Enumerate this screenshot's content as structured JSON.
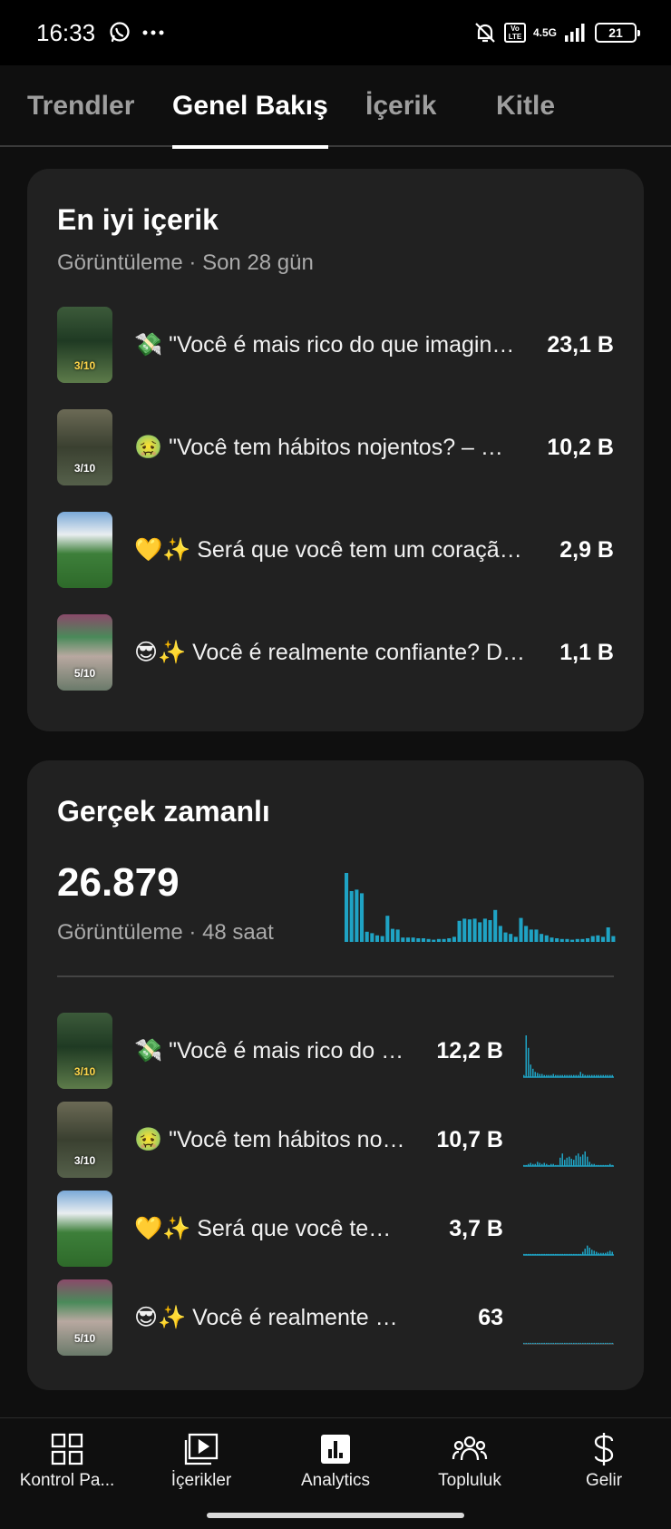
{
  "status_bar": {
    "time": "16:33",
    "volte": "Vo LTE",
    "network": "4.5G",
    "battery": "21"
  },
  "tabs": [
    {
      "label": "Trendler",
      "active": false
    },
    {
      "label": "Genel Bakış",
      "active": true
    },
    {
      "label": "İçerik",
      "active": false
    },
    {
      "label": "Kitle",
      "active": false
    }
  ],
  "top_content": {
    "title": "En iyi içerik",
    "subtitle": "Görüntüleme · Son 28 gün",
    "items": [
      {
        "title": "💸 \"Você é mais rico do que imaginava?",
        "views": "23,1 B",
        "thumb_label": "3/10",
        "thumb_icon": "video-thumbnail-green-path"
      },
      {
        "title": "🤢 \"Você tem hábitos nojentos? – Descubra",
        "views": "10,2 B",
        "thumb_label": "3/10",
        "thumb_icon": "video-thumbnail-forest"
      },
      {
        "title": "💛✨ Será que você tem um coração de ouro?",
        "views": "2,9 B",
        "thumb_label": "",
        "thumb_icon": "video-thumbnail-sunrise-field"
      },
      {
        "title": "😎✨ Você é realmente confiante? Descubra",
        "views": "1,1 B",
        "thumb_label": "5/10",
        "thumb_icon": "video-thumbnail-hand-colorful"
      }
    ]
  },
  "realtime": {
    "title": "Gerçek zamanlı",
    "total": "26.879",
    "subtitle": "Görüntüleme · 48 saat",
    "accent_color": "#1fa3c4",
    "bars": [
      95,
      70,
      72,
      67,
      14,
      12,
      9,
      8,
      36,
      18,
      17,
      6,
      6,
      6,
      5,
      5,
      4,
      3,
      4,
      4,
      5,
      7,
      29,
      32,
      31,
      32,
      27,
      32,
      30,
      44,
      22,
      13,
      11,
      7,
      33,
      22,
      17,
      17,
      11,
      9,
      6,
      5,
      4,
      4,
      3,
      4,
      4,
      5,
      8,
      9,
      7,
      20,
      8
    ],
    "items": [
      {
        "title": "💸 \"Você é mais rico do que imaginava?",
        "views": "12,2 B",
        "thumb_label": "3/10",
        "thumb_icon": "video-thumbnail-green-path",
        "spark": [
          2,
          40,
          28,
          12,
          8,
          5,
          4,
          3,
          3,
          2,
          2,
          2,
          2,
          3,
          2,
          2,
          2,
          2,
          2,
          2,
          2,
          2,
          2,
          2,
          2,
          5,
          3,
          2,
          2,
          2,
          2,
          2,
          2,
          2,
          2,
          2,
          2,
          2,
          2,
          2
        ]
      },
      {
        "title": "🤢 \"Você tem hábitos nojentos? – Descubra",
        "views": "10,7 B",
        "thumb_label": "3/10",
        "thumb_icon": "video-thumbnail-forest",
        "spark": [
          1,
          1,
          2,
          3,
          2,
          2,
          4,
          3,
          2,
          3,
          2,
          1,
          2,
          2,
          1,
          1,
          8,
          12,
          6,
          8,
          9,
          7,
          6,
          10,
          12,
          9,
          11,
          14,
          9,
          4,
          2,
          2,
          1,
          1,
          1,
          1,
          1,
          1,
          2,
          1
        ]
      },
      {
        "title": "💛✨ Será que você tem um coração de ouro?",
        "views": "3,7 B",
        "thumb_label": "",
        "thumb_icon": "video-thumbnail-sunrise-field",
        "spark": [
          1,
          1,
          1,
          1,
          1,
          1,
          1,
          1,
          1,
          1,
          1,
          1,
          1,
          1,
          1,
          1,
          1,
          1,
          1,
          1,
          1,
          1,
          1,
          1,
          1,
          1,
          3,
          6,
          9,
          7,
          5,
          4,
          3,
          2,
          2,
          2,
          2,
          3,
          4,
          3
        ]
      },
      {
        "title": "😎✨ Você é realmente confiante? Descubra",
        "views": "63",
        "thumb_label": "5/10",
        "thumb_icon": "video-thumbnail-hand-colorful",
        "spark": [
          1,
          1,
          1,
          1,
          1,
          1,
          1,
          1,
          1,
          1,
          1,
          1,
          1,
          1,
          1,
          1,
          1,
          1,
          1,
          1,
          1,
          1,
          1,
          1,
          1,
          1,
          1,
          1,
          1,
          1,
          1,
          1,
          1,
          1,
          1,
          1,
          1,
          1,
          1,
          1
        ]
      }
    ]
  },
  "bottom_nav": [
    {
      "label": "Kontrol Pa...",
      "icon": "dashboard-icon"
    },
    {
      "label": "İçerikler",
      "icon": "content-icon"
    },
    {
      "label": "Analytics",
      "icon": "analytics-icon"
    },
    {
      "label": "Topluluk",
      "icon": "community-icon"
    },
    {
      "label": "Gelir",
      "icon": "earn-icon"
    }
  ]
}
